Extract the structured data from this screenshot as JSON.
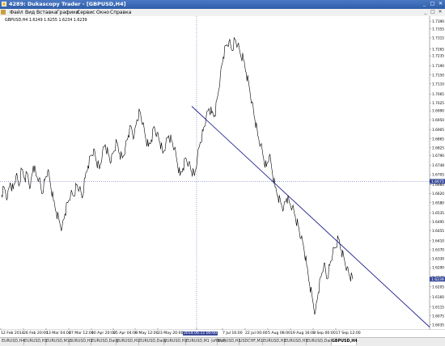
{
  "window": {
    "title": "4289: Dukascopy Trader - [GBPUSD,H4]",
    "minimize_glyph": "_",
    "maximize_glyph": "□",
    "close_glyph": "✕",
    "icon": "app-icon"
  },
  "menu": {
    "items": [
      "Файл",
      "Вид",
      "Вставка",
      "Графики",
      "Сервис",
      "Окно",
      "Справка"
    ],
    "controls": [
      "_",
      "□",
      "✕"
    ]
  },
  "chart_info": "GBPUSD,H4 1.6249 1.6255 1.6234 1.6239",
  "chart_data": {
    "type": "line",
    "symbol": "GBPUSD",
    "timeframe": "H4",
    "ohlc_label": "GBPUSD,H4 1.6249 1.6255 1.6234 1.6239",
    "y_ticks": [
      "1.7390",
      "1.7355",
      "1.7315",
      "1.7265",
      "1.7235",
      "1.7190",
      "1.7150",
      "1.7110",
      "1.7065",
      "1.7025",
      "1.6990",
      "1.6950",
      "1.6905",
      "1.6865",
      "1.6825",
      "1.6790",
      "1.6748",
      "1.6705",
      "1.6660",
      "1.6620",
      "1.6580",
      "1.6535",
      "1.6495",
      "1.6455",
      "1.6410",
      "1.6370",
      "1.6330",
      "1.6290",
      "1.6245",
      "1.6205",
      "1.6160",
      "1.6115",
      "1.6075",
      "1.6035"
    ],
    "ylim": [
      1.602,
      1.7405
    ],
    "current_price": "1.6239",
    "crosshair_price": "1.6675",
    "crosshair_time": "2014.06.11 00:00",
    "x_ticks": [
      "12 Feb 2014",
      "26 Feb 20:00",
      "13 Mar 04:00",
      "27 Mar 12:00",
      "10 Apr 20:00",
      "25 Apr 04:00",
      "9 May 12:00",
      "23 May 20:00",
      "2014.06.11 00:00",
      "7 Jul 16:00",
      "22 Jul 00:00",
      "5 Aug 08:00",
      "19 Aug 16:00",
      "3 Sep 00:00",
      "17 Sep 12:00"
    ],
    "series": [
      {
        "values": [
          1.6615,
          1.6645,
          1.66,
          1.667,
          1.664,
          1.67,
          1.6655,
          1.673,
          1.669,
          1.671,
          1.665,
          1.6745,
          1.67,
          1.669,
          1.662,
          1.668,
          1.672,
          1.666,
          1.659,
          1.654,
          1.65,
          1.647,
          1.653,
          1.658,
          1.662,
          1.661,
          1.666,
          1.664,
          1.66,
          1.669,
          1.6745,
          1.679,
          1.682,
          1.676,
          1.673,
          1.68,
          1.684,
          1.68,
          1.676,
          1.681,
          1.685,
          1.68,
          1.678,
          1.683,
          1.688,
          1.692,
          1.687,
          1.695,
          1.699,
          1.693,
          1.687,
          1.683,
          1.686,
          1.692,
          1.689,
          1.685,
          1.68,
          1.684,
          1.688,
          1.686,
          1.682,
          1.676,
          1.67,
          1.6735,
          1.678,
          1.676,
          1.672,
          1.67,
          1.678,
          1.685,
          1.69,
          1.695,
          1.7,
          1.698,
          1.697,
          1.705,
          1.715,
          1.723,
          1.728,
          1.73,
          1.726,
          1.731,
          1.728,
          1.724,
          1.722,
          1.716,
          1.71,
          1.703,
          1.695,
          1.688,
          1.684,
          1.678,
          1.674,
          1.679,
          1.672,
          1.665,
          1.661,
          1.658,
          1.656,
          1.66,
          1.658,
          1.656,
          1.652,
          1.648,
          1.642,
          1.638,
          1.63,
          1.622,
          1.615,
          1.609,
          1.618,
          1.625,
          1.631,
          1.624,
          1.63,
          1.635,
          1.638,
          1.642,
          1.637,
          1.633,
          1.629,
          1.625,
          1.6239
        ]
      },
      {
        "name": "trendline",
        "values": [
          1.701,
          1.6025
        ]
      }
    ],
    "grid": false,
    "colors": {
      "price": "#000000",
      "trendline": "#1e1e8c",
      "crosshair": "#3a4a9a",
      "current_price_bg": "#3a4a9a"
    }
  },
  "tabs": {
    "items": [
      "EURUSD,H4",
      "EURUSD,H1",
      "EURUSD,M15",
      "EURUSD,H1",
      "EURUSD,Daily",
      "EURUSD,H1",
      "EURUSD,Daily",
      "EURUSD,H1",
      "EURUSD,M1 (offline)",
      "EURUSD,H1",
      "USDCHF,M1",
      "EURUSD,H1",
      "EURUSD,H1",
      "EURUSD,Daily",
      "GBPUSD,H4"
    ],
    "active_index": 14
  }
}
